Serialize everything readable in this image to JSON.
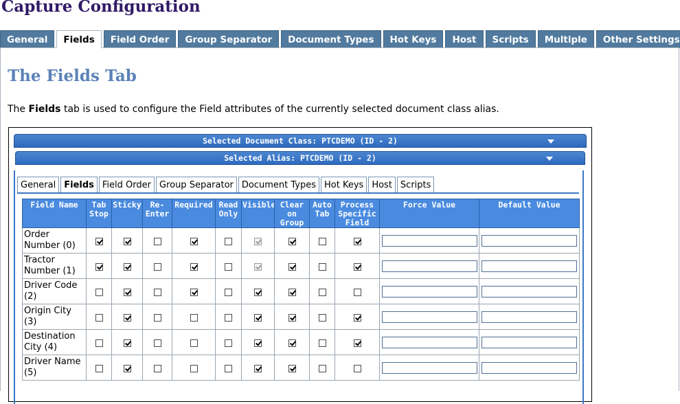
{
  "page": {
    "title": "Capture Configuration"
  },
  "top_tabs": [
    "General",
    "Fields",
    "Field Order",
    "Group Separator",
    "Document Types",
    "Hot Keys",
    "Host",
    "Scripts",
    "Multiple",
    "Other Settings"
  ],
  "top_tab_active": "Fields",
  "section": {
    "heading": "The Fields Tab",
    "intro_before": "The ",
    "intro_bold": "Fields",
    "intro_after": " tab is used to configure the Field attributes of the currently selected document class alias."
  },
  "screenshot": {
    "doc_class_bar": "Selected Document Class: PTCDEMO (ID - 2)",
    "alias_bar": "Selected Alias: PTCDEMO (ID - 2)",
    "tabs": [
      "General",
      "Fields",
      "Field Order",
      "Group Separator",
      "Document Types",
      "Hot Keys",
      "Host",
      "Scripts"
    ],
    "active_tab": "Fields",
    "columns": [
      "Field Name",
      "Tab Stop",
      "Sticky",
      "Re-Enter",
      "Required",
      "Read Only",
      "Visible",
      "Clear on Group",
      "Auto Tab",
      "Process Specific Field",
      "Force Value",
      "Default Value"
    ],
    "rows": [
      {
        "name": "Order Number (0)",
        "flags": [
          true,
          true,
          false,
          true,
          false,
          true,
          true,
          false,
          true
        ],
        "visible_disabled": true
      },
      {
        "name": "Tractor Number (1)",
        "flags": [
          true,
          true,
          false,
          true,
          false,
          true,
          true,
          false,
          true
        ],
        "visible_disabled": true
      },
      {
        "name": "Driver Code (2)",
        "flags": [
          false,
          true,
          false,
          true,
          false,
          true,
          true,
          false,
          false
        ],
        "visible_disabled": false
      },
      {
        "name": "Origin City (3)",
        "flags": [
          false,
          true,
          false,
          false,
          false,
          true,
          true,
          false,
          true
        ],
        "visible_disabled": false
      },
      {
        "name": "Destination City (4)",
        "flags": [
          false,
          true,
          false,
          false,
          false,
          true,
          true,
          false,
          true
        ],
        "visible_disabled": false
      },
      {
        "name": "Driver Name (5)",
        "flags": [
          false,
          true,
          false,
          false,
          false,
          true,
          true,
          false,
          false
        ],
        "visible_disabled": false
      }
    ]
  },
  "colors": {
    "tab_blue": "#517a9e",
    "title_purple": "#2f1a66",
    "heading_blue": "#5b82b8",
    "bar_blue": "#2e6bbf",
    "header_blue": "#4a8be0"
  }
}
